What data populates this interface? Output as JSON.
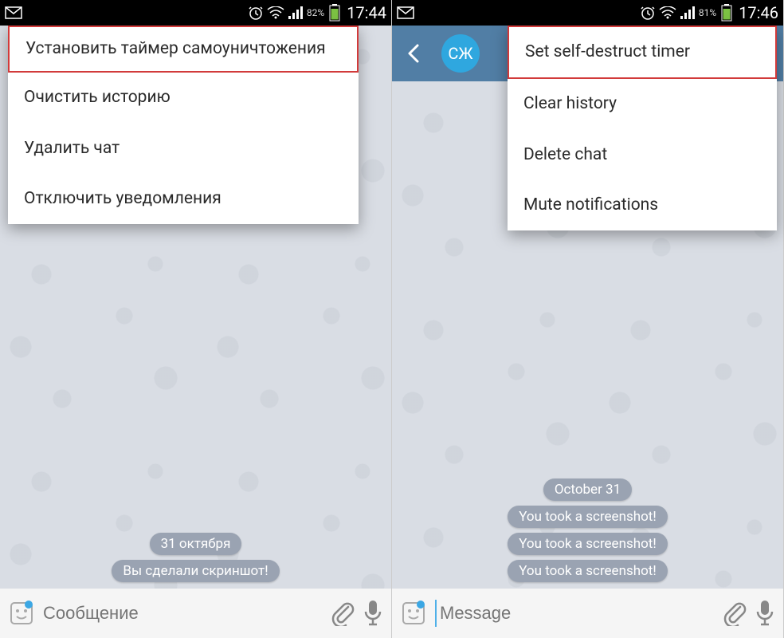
{
  "screens": [
    {
      "statusbar": {
        "battery_pct": "82%",
        "time": "17:44"
      },
      "menu": {
        "items": [
          "Установить таймер самоуничтожения",
          "Очистить историю",
          "Удалить чат",
          "Отключить уведомления"
        ],
        "highlighted_index": 0
      },
      "chat": {
        "pills": [
          "31 октября",
          "Вы сделали скриншот!"
        ]
      },
      "input": {
        "placeholder": "Сообщение",
        "has_cursor": false
      }
    },
    {
      "statusbar": {
        "battery_pct": "81%",
        "time": "17:46"
      },
      "appbar": {
        "avatar_text": "СЖ"
      },
      "menu": {
        "items": [
          "Set self-destruct timer",
          "Clear history",
          "Delete chat",
          "Mute notifications"
        ],
        "highlighted_index": 0
      },
      "chat": {
        "pills": [
          "October 31",
          "You took a screenshot!",
          "You took a screenshot!",
          "You took a screenshot!"
        ]
      },
      "input": {
        "placeholder": "Message",
        "has_cursor": true
      }
    }
  ]
}
